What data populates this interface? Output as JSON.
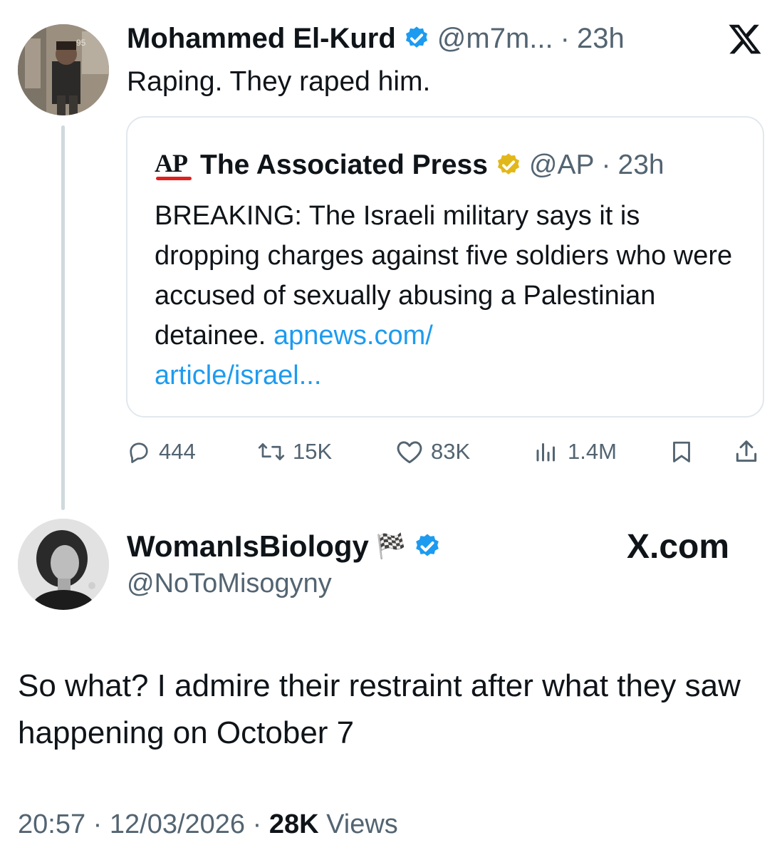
{
  "tweet1": {
    "display_name": "Mohammed El-Kurd",
    "handle": "@m7m...",
    "separator": "·",
    "time": "23h",
    "text": "Raping. They raped him.",
    "avatar_tag": "95"
  },
  "quote": {
    "logo_text": "AP",
    "display_name": "The Associated Press",
    "handle": "@AP",
    "separator": "·",
    "time": "23h",
    "text": "BREAKING: The Israeli military says it is dropping charges against five soldiers who were accused of sexually abusing a Palestinian detainee.",
    "link_line1": "apnews.com/",
    "link_line2": "article/israel..."
  },
  "actions": {
    "replies": "444",
    "reposts": "15K",
    "likes": "83K",
    "views": "1.4M"
  },
  "tweet2": {
    "display_name": "WomanIsBiology",
    "flag_emoji": "🏁",
    "handle": "@NoToMisogyny",
    "watermark": "X.com",
    "text": "So what? I admire their restraint after what they saw happening on October 7",
    "time": "20:57",
    "sep1": "·",
    "date": "12/03/2026",
    "sep2": "·",
    "views_count": "28K",
    "views_label": "Views"
  },
  "colors": {
    "text": "#0f1419",
    "muted": "#536471",
    "link": "#1d9bf0",
    "verified_blue": "#1d9bf0",
    "verified_gold": "#e2b719",
    "border": "#e1e8ed",
    "ap_red": "#e0201f"
  },
  "icons": {
    "x_logo": "x-logo-icon",
    "verified": "verified-badge-icon",
    "reply": "reply-icon",
    "repost": "repost-icon",
    "like": "heart-icon",
    "views": "views-chart-icon",
    "bookmark": "bookmark-icon",
    "share": "share-icon"
  }
}
